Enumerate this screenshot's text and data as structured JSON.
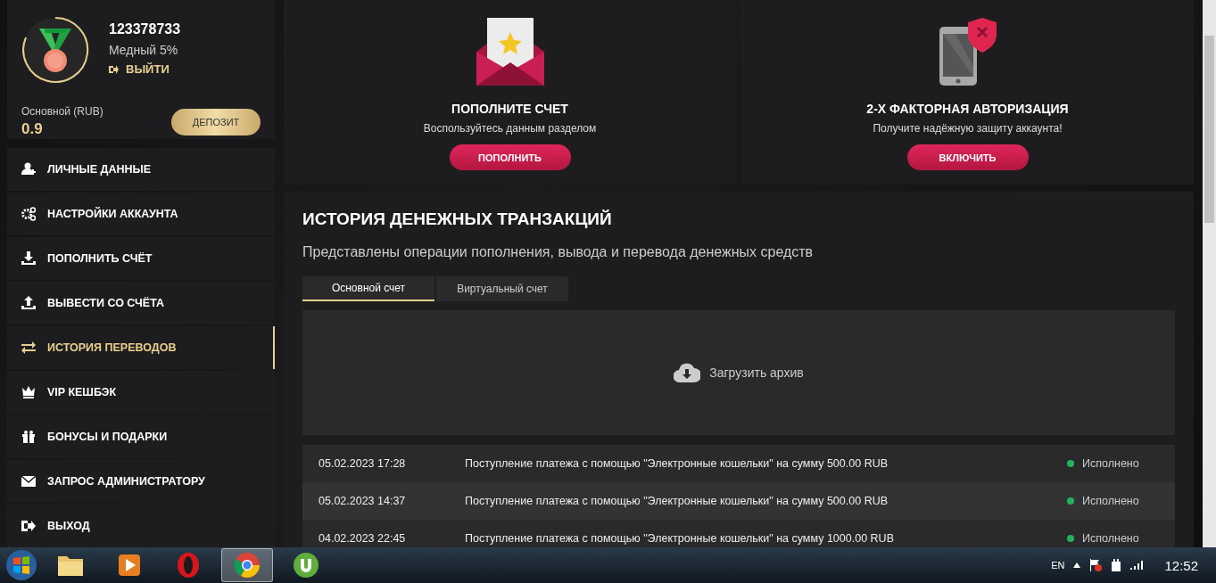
{
  "profile": {
    "user_id": "123378733",
    "rank": "Медный 5%",
    "logout": "ВЫЙТИ"
  },
  "balance": {
    "label": "Основной (RUB)",
    "amount": "0.9",
    "button": "ДЕПОЗИТ"
  },
  "menu": [
    {
      "label": "ЛИЧНЫЕ ДАННЫЕ",
      "selected": false
    },
    {
      "label": "НАСТРОЙКИ АККАУНТА",
      "selected": false
    },
    {
      "label": "ПОПОЛНИТЬ СЧЁТ",
      "selected": false
    },
    {
      "label": "ВЫВЕСТИ СО СЧЁТА",
      "selected": false
    },
    {
      "label": "ИСТОРИЯ ПЕРЕВОДОВ",
      "selected": true
    },
    {
      "label": "VIP КЕШБЭК",
      "selected": false
    },
    {
      "label": "БОНУСЫ И ПОДАРКИ",
      "selected": false
    },
    {
      "label": "ЗАПРОС АДМИНИСТРАТОРУ",
      "selected": false
    },
    {
      "label": "ВЫХОД",
      "selected": false
    }
  ],
  "promo_cards": [
    {
      "title": "ПОПОЛНИТЕ СЧЕТ",
      "text": "Воспользуйтесь данным разделом",
      "button": "ПОПОЛНИТЬ"
    },
    {
      "title": "2-Х ФАКТОРНАЯ АВТОРИЗАЦИЯ",
      "text": "Получите надёжную защиту аккаунта!",
      "button": "ВКЛЮЧИТЬ"
    }
  ],
  "history": {
    "title": "ИСТОРИЯ ДЕНЕЖНЫХ ТРАНЗАКЦИЙ",
    "subtitle": "Представлены операции пополнения, вывода и перевода денежных средств",
    "tabs": [
      {
        "label": "Основной счет",
        "selected": true
      },
      {
        "label": "Виртуальный счет",
        "selected": false
      }
    ],
    "archive_button": "Загрузить архив",
    "rows": [
      {
        "date": "05.02.2023 17:28",
        "text": "Поступление платежа с помощью \"Электронные кошельки\" на сумму 500.00 RUB",
        "status": "Исполнено",
        "color": "#22b35a"
      },
      {
        "date": "05.02.2023 14:37",
        "text": "Поступление платежа с помощью \"Электронные кошельки\" на сумму 500.00 RUB",
        "status": "Исполнено",
        "color": "#22b35a"
      },
      {
        "date": "04.02.2023 22:45",
        "text": "Поступление платежа с помощью \"Электронные кошельки\" на сумму 1000.00 RUB",
        "status": "Исполнено",
        "color": "#22b35a"
      }
    ]
  },
  "taskbar": {
    "apps": [
      {
        "selected": false
      },
      {
        "selected": false
      },
      {
        "selected": false
      },
      {
        "selected": true
      },
      {
        "selected": false
      }
    ],
    "language": "EN",
    "clock": "12:52"
  }
}
